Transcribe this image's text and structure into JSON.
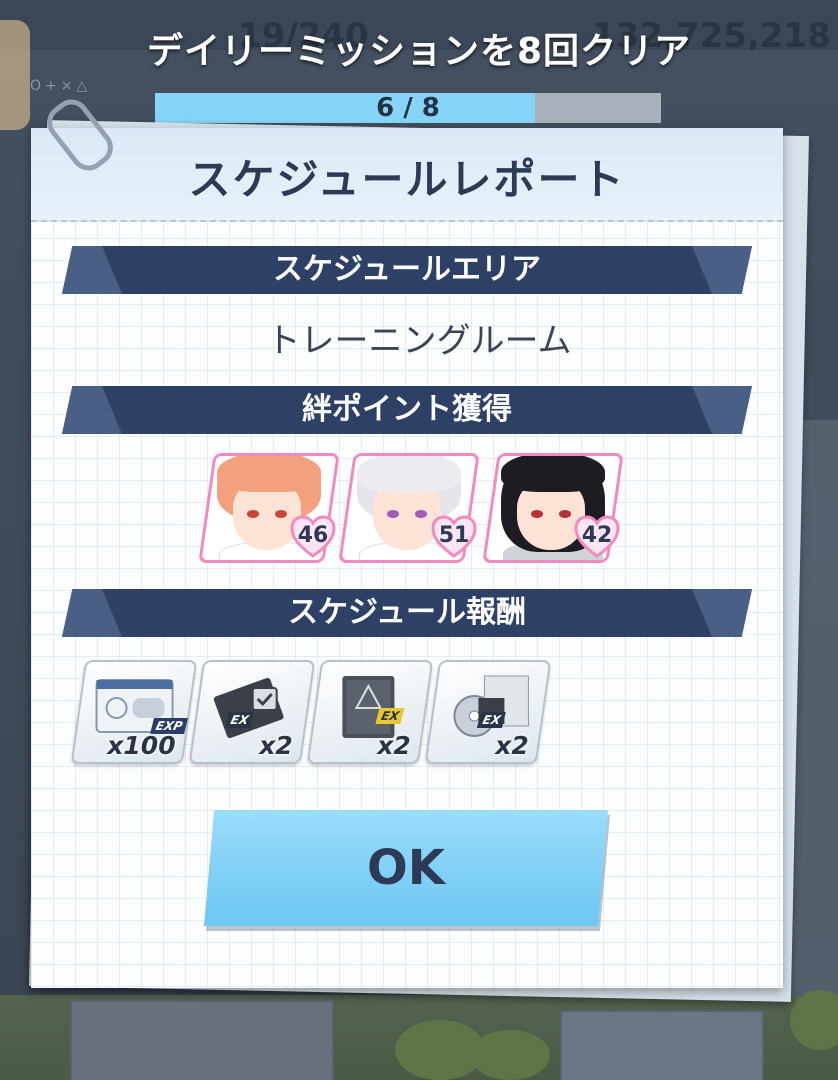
{
  "background": {
    "ap_text": "19/240",
    "credit_text": "132,725,218",
    "board_symbols": "O+×△"
  },
  "mission_toast": {
    "title": "デイリーミッションを8回クリア",
    "progress_text": "6 / 8",
    "progress_current": 6,
    "progress_total": 8,
    "fill_color": "#86d4f6"
  },
  "dialog": {
    "title": "スケジュールレポート",
    "sections": {
      "area": {
        "label": "スケジュールエリア",
        "value": "トレーニングルーム"
      },
      "bond": {
        "label": "絆ポイント獲得"
      },
      "rewards": {
        "label": "スケジュール報酬"
      }
    },
    "characters": [
      {
        "name_icon": "orange-hair-student-portrait",
        "bond_points": "46"
      },
      {
        "name_icon": "white-hair-student-portrait",
        "bond_points": "51"
      },
      {
        "name_icon": "black-hair-student-portrait",
        "bond_points": "42"
      }
    ],
    "rewards": [
      {
        "icon": "exp-report-icon",
        "tag": "EXP",
        "qty": "x100"
      },
      {
        "icon": "ex-select-item-icon",
        "tag": "EX",
        "qty": "x2"
      },
      {
        "icon": "abydos-book-icon",
        "tag": "EX",
        "qty": "x2"
      },
      {
        "icon": "disc-item-icon",
        "tag": "EX",
        "qty": "x2"
      }
    ],
    "ok_label": "OK"
  },
  "colors": {
    "section_bar": "#2f4066",
    "accent_pink": "#f28ac0",
    "button_blue": "#86d4f6"
  }
}
